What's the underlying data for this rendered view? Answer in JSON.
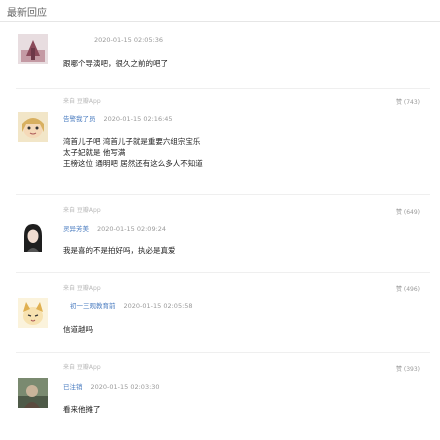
{
  "header": {
    "title": "最新回应"
  },
  "comments": [
    {
      "source": "",
      "username": "",
      "time": "2020-01-15 02:05:36",
      "lines": [
        "跟哪个导演吧，很久之前的吧了"
      ],
      "likes": ""
    },
    {
      "source": "来自 豆瓣App",
      "username": "告警我了员",
      "time": "2020-01-15 02:16:45",
      "lines": [
        "湾首儿子吧 湾首儿子就是重要六组宗宝乐",
        "太子妃就是 他写满",
        "王榜这位 通明吧 居然还有这么多人不知道"
      ],
      "likes": "赞 (743)"
    },
    {
      "source": "来自 豆瓣App",
      "username": "灵异芳美",
      "time": "2020-01-15 02:09:24",
      "lines": [
        "我是喜的不是拍好吗，执必是真爱"
      ],
      "likes": "赞 (649)"
    },
    {
      "source": "来自 豆瓣App",
      "username": "初一三观教育前",
      "time": "2020-01-15 02:05:58",
      "lines": [
        "信道越吗"
      ],
      "likes": "赞 (496)"
    },
    {
      "source": "来自 豆瓣App",
      "username": "已注销",
      "time": "2020-01-15 02:03:30",
      "lines": [
        "看来他摊了"
      ],
      "likes": "赞 (393)"
    }
  ]
}
